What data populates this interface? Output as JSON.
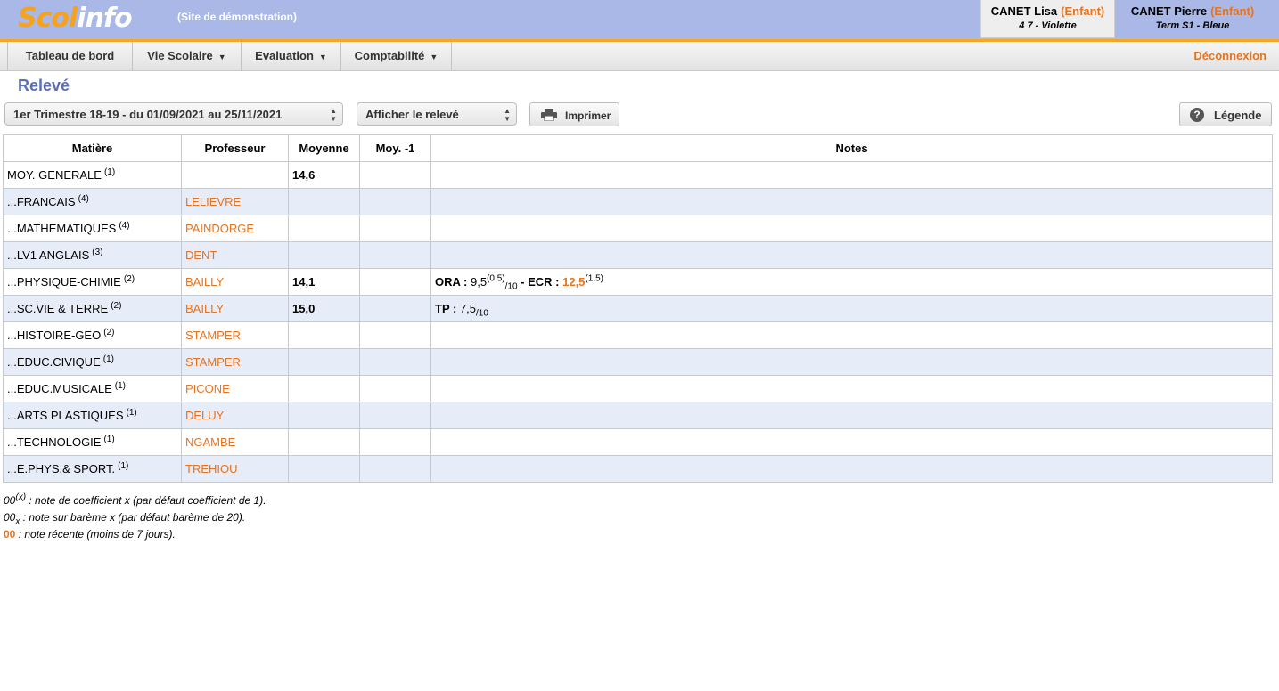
{
  "header": {
    "logo_part1": "Scol",
    "logo_part2": "info",
    "site_subtitle": "(Site de démonstration)",
    "children": [
      {
        "name": "CANET Lisa",
        "role": "(Enfant)",
        "class": "4 7 - Violette",
        "active": true
      },
      {
        "name": "CANET Pierre",
        "role": "(Enfant)",
        "class": "Term S1 - Bleue",
        "active": false
      }
    ]
  },
  "nav": {
    "items": [
      "Tableau de bord",
      "Vie Scolaire",
      "Evaluation",
      "Comptabilité"
    ],
    "logout": "Déconnexion"
  },
  "page": {
    "title": "Relevé",
    "period_select": "1er Trimestre 18-19 - du 01/09/2021 au 25/11/2021",
    "display_select": "Afficher le relevé",
    "print_button": "Imprimer",
    "legend_button": "Légende"
  },
  "table": {
    "headers": [
      "Matière",
      "Professeur",
      "Moyenne",
      "Moy. -1",
      "Notes"
    ],
    "rows": [
      {
        "subject": "MOY. GENERALE",
        "coef": "(1)",
        "teacher": "",
        "avg": "14,6",
        "prev": ""
      },
      {
        "subject": "...FRANCAIS",
        "coef": "(4)",
        "teacher": "LELIEVRE",
        "avg": "",
        "prev": ""
      },
      {
        "subject": "...MATHEMATIQUES",
        "coef": "(4)",
        "teacher": "PAINDORGE",
        "avg": "",
        "prev": ""
      },
      {
        "subject": "...LV1 ANGLAIS",
        "coef": "(3)",
        "teacher": "DENT",
        "avg": "",
        "prev": ""
      },
      {
        "subject": "...PHYSIQUE-CHIMIE",
        "coef": "(2)",
        "teacher": "BAILLY",
        "avg": "14,1",
        "prev": ""
      },
      {
        "subject": "...SC.VIE & TERRE",
        "coef": "(2)",
        "teacher": "BAILLY",
        "avg": "15,0",
        "prev": ""
      },
      {
        "subject": "...HISTOIRE-GEO",
        "coef": "(2)",
        "teacher": "STAMPER",
        "avg": "",
        "prev": ""
      },
      {
        "subject": "...EDUC.CIVIQUE",
        "coef": "(1)",
        "teacher": "STAMPER",
        "avg": "",
        "prev": ""
      },
      {
        "subject": "...EDUC.MUSICALE",
        "coef": "(1)",
        "teacher": "PICONE",
        "avg": "",
        "prev": ""
      },
      {
        "subject": "...ARTS PLASTIQUES",
        "coef": "(1)",
        "teacher": "DELUY",
        "avg": "",
        "prev": ""
      },
      {
        "subject": "...TECHNOLOGIE",
        "coef": "(1)",
        "teacher": "NGAMBE",
        "avg": "",
        "prev": ""
      },
      {
        "subject": "...E.PHYS.& SPORT.",
        "coef": "(1)",
        "teacher": "TREHIOU",
        "avg": "",
        "prev": ""
      }
    ],
    "notes": {
      "physique": {
        "ora_label": "ORA :",
        "ora_value": "9,5",
        "ora_coef": "(0,5)",
        "ora_bareme": "/10",
        "sep": " - ",
        "ecr_label": "ECR :",
        "ecr_value": "12,5",
        "ecr_coef": "(1,5)"
      },
      "svt": {
        "tp_label": "TP :",
        "tp_value": "7,5",
        "tp_bareme": "/10"
      }
    }
  },
  "legend": {
    "coef_sample": "00",
    "coef_sup": "(x)",
    "coef_text": " : note de coefficient x (par défaut coefficient de 1).",
    "bareme_sample": "00",
    "bareme_sub": "x",
    "bareme_text": " : note sur barème x (par défaut barème de 20).",
    "recent_sample": "00",
    "recent_text": " : note récente (moins de 7 jours)."
  },
  "colors": {
    "header_bg": "#a9b8e6",
    "accent_orange": "#e8731c",
    "title_blue": "#5b6fb5",
    "row_alt": "#e6ecf8"
  }
}
